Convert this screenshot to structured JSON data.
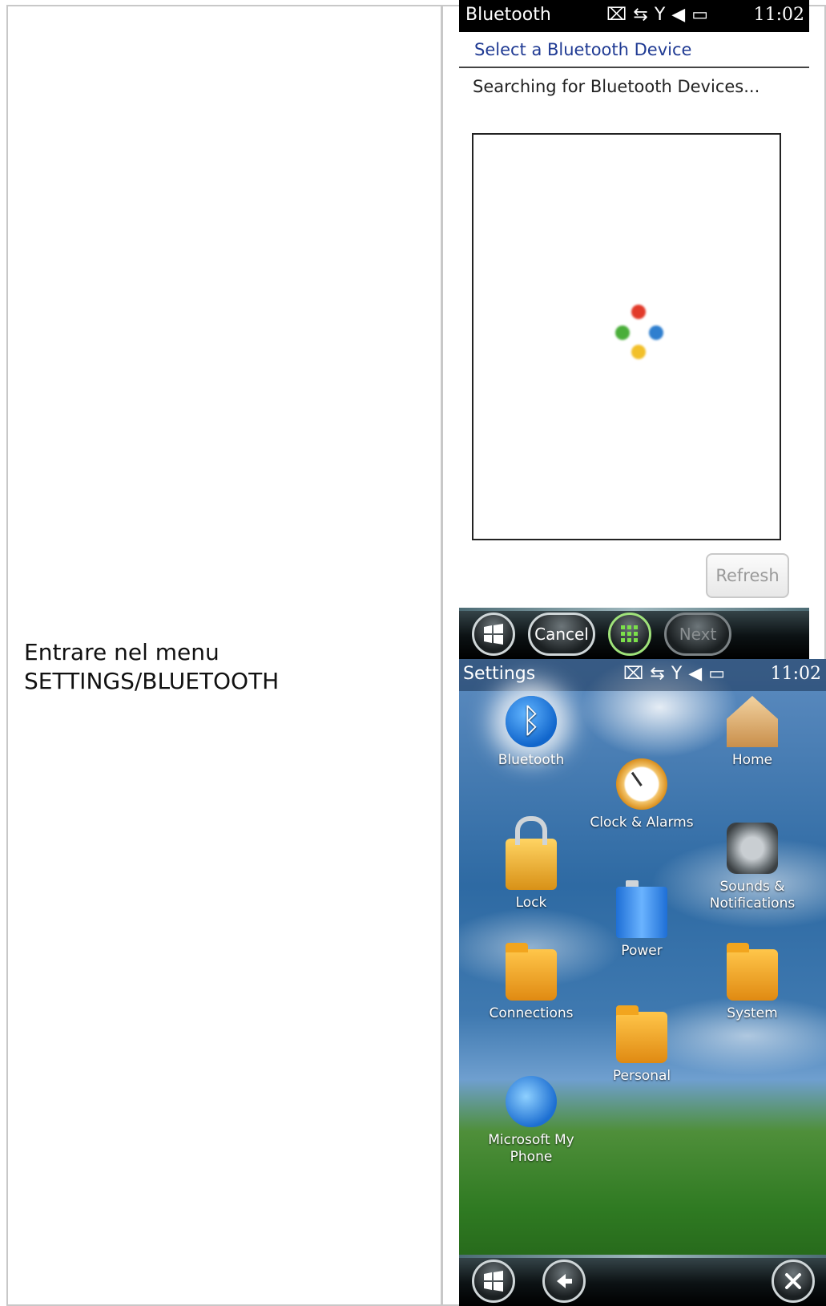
{
  "instruction": {
    "line1": "Entrare nel menu",
    "line2": "SETTINGS/BLUETOOTH"
  },
  "bluetooth_screen": {
    "status_bar": {
      "title": "Bluetooth",
      "time": "11:02",
      "icons": [
        "sim-icon",
        "sync-icon",
        "signal-off-icon",
        "volume-icon",
        "battery-icon"
      ]
    },
    "subtitle": "Select a Bluetooth Device",
    "status_text": "Searching for Bluetooth Devices...",
    "refresh_label": "Refresh",
    "softbar": {
      "cancel_label": "Cancel",
      "next_label": "Next"
    }
  },
  "settings_screen": {
    "status_bar": {
      "title": "Settings",
      "time": "11:02"
    },
    "tiles": [
      {
        "label": "Bluetooth",
        "icon": "bluetooth-icon"
      },
      {
        "label": "Clock & Alarms",
        "icon": "clock-icon"
      },
      {
        "label": "Home",
        "icon": "home-icon"
      },
      {
        "label": "Lock",
        "icon": "lock-icon"
      },
      {
        "label": "Power",
        "icon": "battery-icon"
      },
      {
        "label": "Sounds &",
        "label2": "Notifications",
        "icon": "speaker-icon"
      },
      {
        "label": "Connections",
        "icon": "connections-folder-icon"
      },
      {
        "label": "Personal",
        "icon": "personal-folder-icon"
      },
      {
        "label": "System",
        "icon": "system-folder-icon"
      },
      {
        "label": "Microsoft My Phone",
        "icon": "my-phone-icon"
      }
    ]
  },
  "colors": {
    "status_bar": "#000000",
    "subtitle": "#1f3a93",
    "softkey_bar": "#0c1214",
    "spinner": [
      "#e23a2a",
      "#2f7fcf",
      "#4aae3a",
      "#f2c02a"
    ]
  }
}
